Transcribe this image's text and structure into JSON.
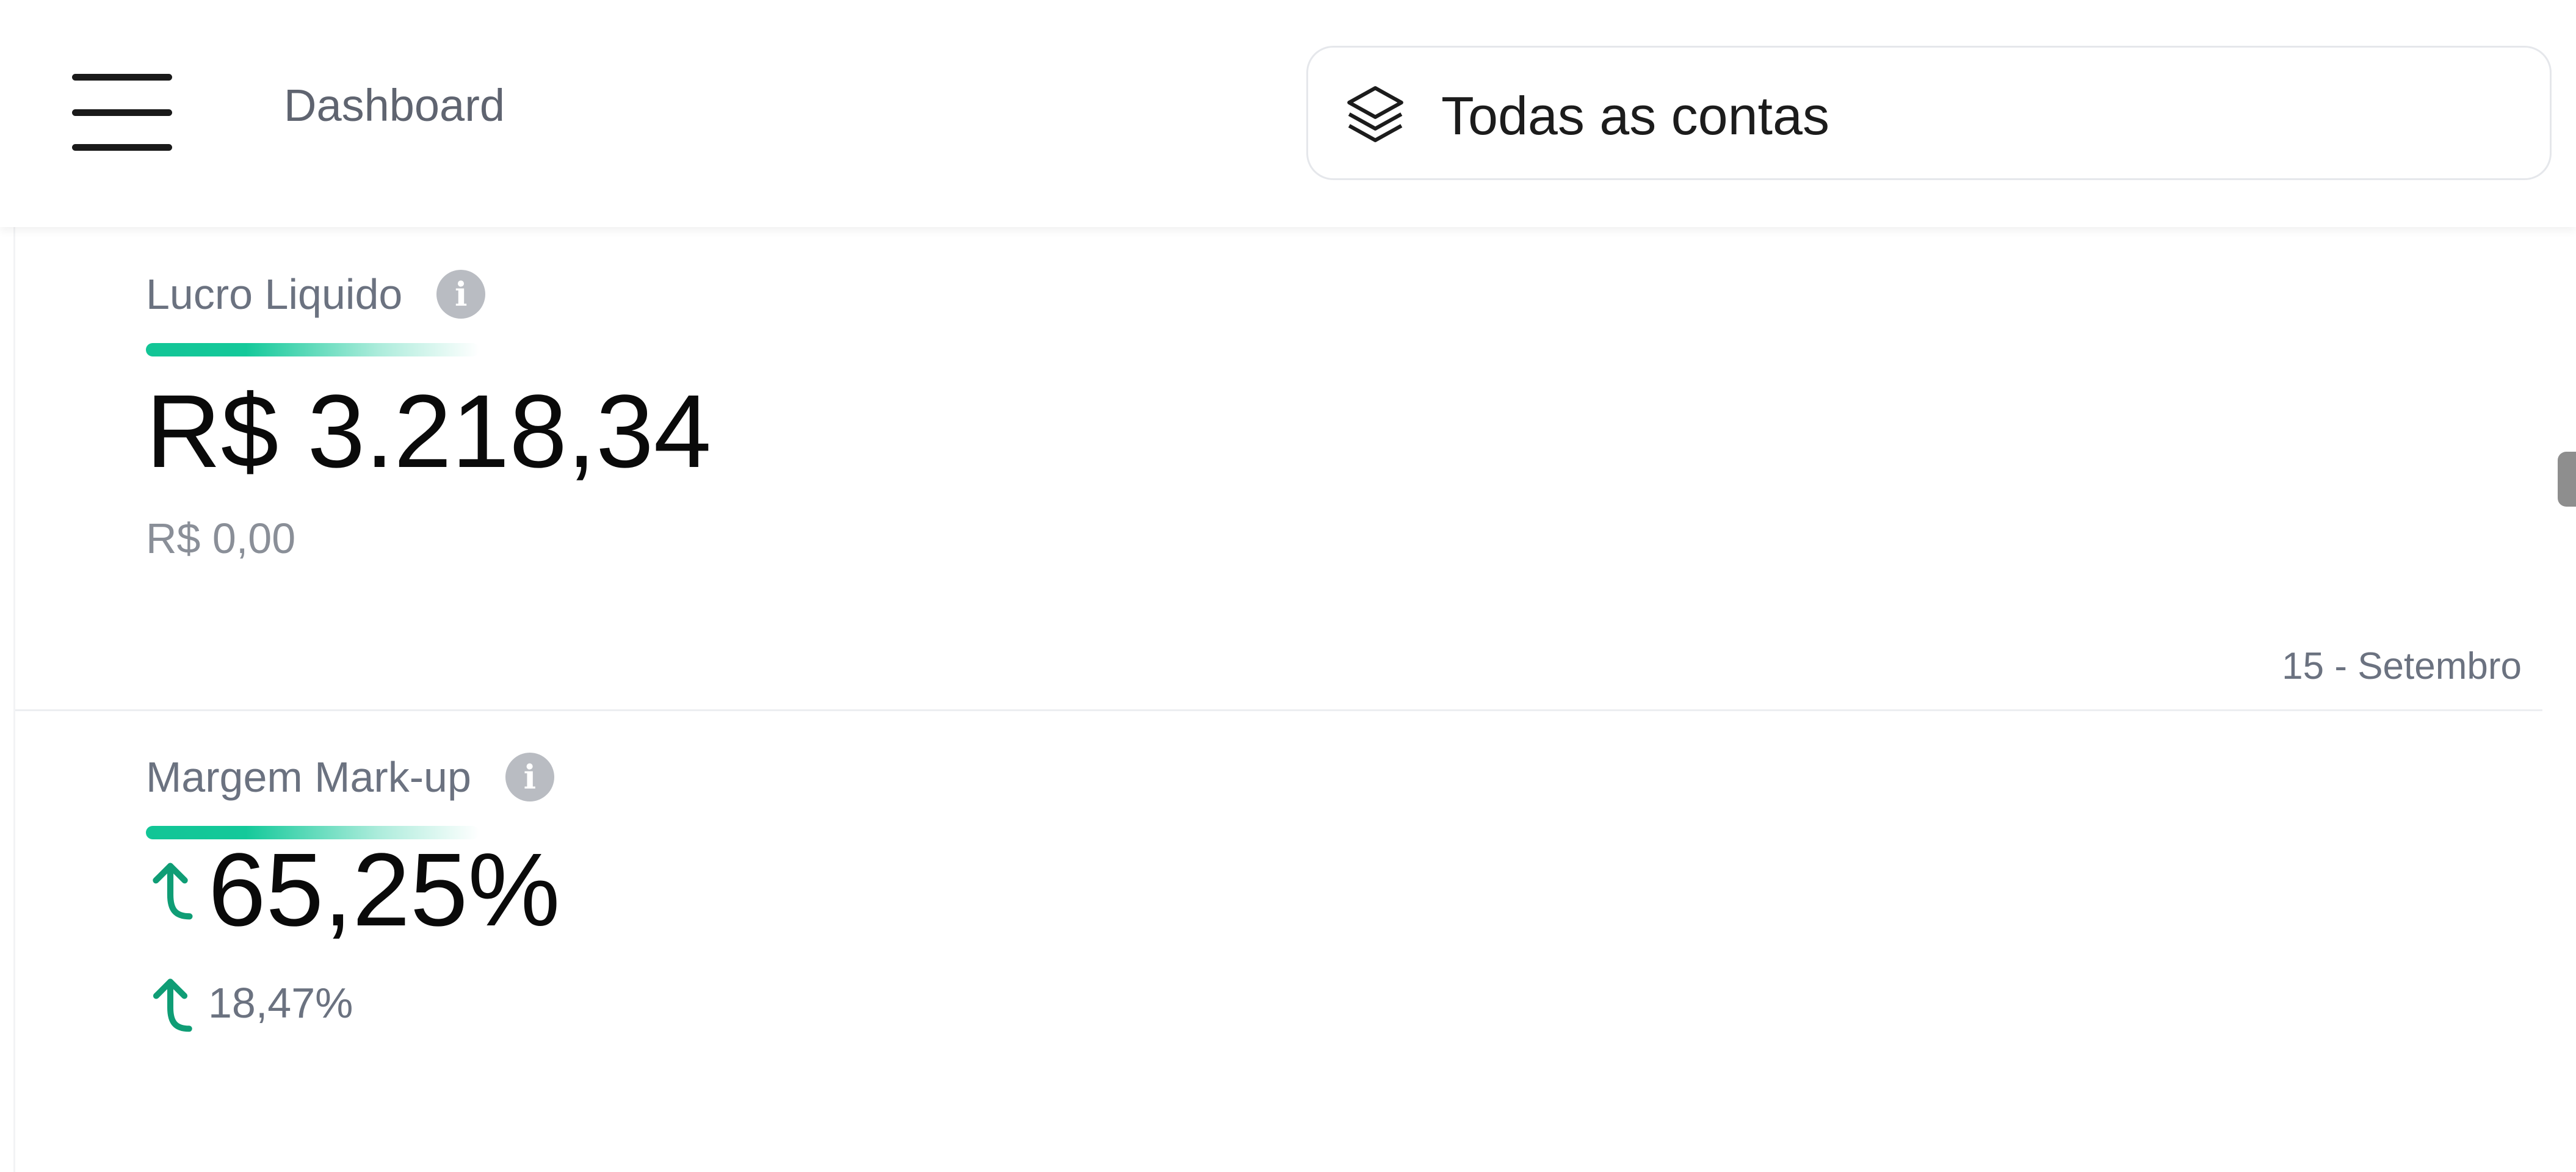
{
  "header": {
    "title": "Dashboard",
    "account_selector": {
      "label": "Todas as contas",
      "icon": "layers-icon"
    },
    "menu_icon": "hamburger-menu-icon"
  },
  "cards": [
    {
      "label": "Lucro Liquido",
      "value": "R$ 3.218,34",
      "comparison": "R$ 0,00",
      "date": "15 - Setembro"
    },
    {
      "label": "Margem Mark-up",
      "value": "65,25%",
      "comparison": "18,47%",
      "trend_icon": "trend-up-arrow-icon"
    }
  ],
  "colors": {
    "accent_green": "#12c596",
    "text_primary": "#0a0a0a",
    "text_muted": "#6b7280",
    "info_icon": "#b9bcc2"
  }
}
